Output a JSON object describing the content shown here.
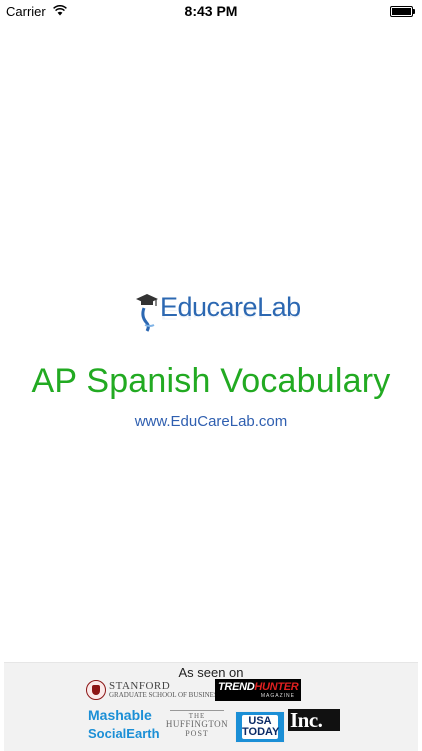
{
  "status_bar": {
    "carrier": "Carrier",
    "time": "8:43 PM",
    "wifi_icon": "wifi-icon",
    "battery_icon": "battery-icon"
  },
  "logo": {
    "text_educare": "Educare",
    "text_lab": "Lab",
    "icon": "graduation-cap-icon",
    "colors": {
      "educare": "#2c68b2",
      "lab": "#2c68b2",
      "cap": "#333333"
    }
  },
  "app_title": "AP Spanish Vocabulary",
  "website": "www.EduCareLab.com",
  "press": {
    "heading": "As seen on",
    "stanford": {
      "name": "STANFORD",
      "sub": "GRADUATE SCHOOL OF BUSINESS"
    },
    "trendhunter": {
      "trend": "TREND",
      "hunter": "HUNTER",
      "sub": "MAGAZINE"
    },
    "mashable": {
      "line1": "Mashable",
      "line2": "SocialEarth"
    },
    "huffpost": {
      "line1": "THE",
      "line2": "HUFFINGTON",
      "line3": "POST"
    },
    "usatoday": {
      "line1": "USA",
      "line2": "TODAY"
    },
    "inc": {
      "text": "Inc."
    }
  },
  "colors": {
    "title_green": "#22aa22",
    "link_blue": "#2f5fb0",
    "press_bg": "#f2f2f2"
  }
}
